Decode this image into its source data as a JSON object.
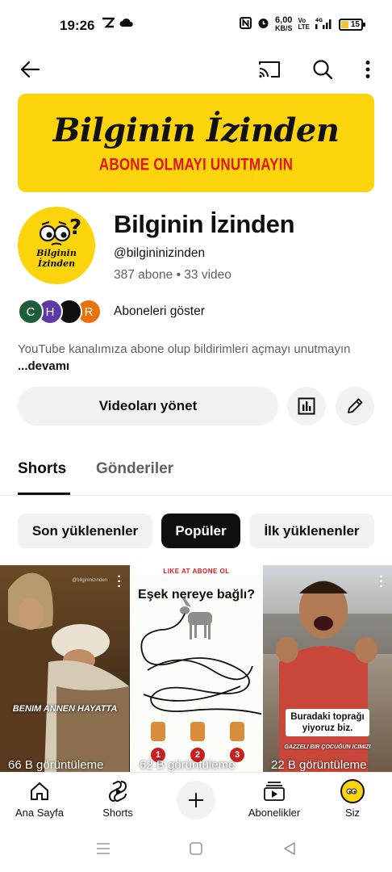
{
  "status_bar": {
    "time": "19:26",
    "speed_top": "6,00",
    "speed_bottom": "KB/S",
    "battery": "15",
    "network": "Vo LTE 4G"
  },
  "banner": {
    "title": "Bilginin İzinden",
    "subtitle": "ABONE OLMAYI UNUTMAYIN"
  },
  "channel": {
    "avatar_text": "Bilginin İzinden",
    "name": "Bilginin İzinden",
    "handle": "@bilgininizinden",
    "stats": "387 abone • 33 video",
    "subscriber_avatars": [
      {
        "letter": "C",
        "color": "#1e5e3a"
      },
      {
        "letter": "H",
        "color": "#5b3aa6"
      },
      {
        "letter": "",
        "color": "#0f0f0f"
      },
      {
        "letter": "R",
        "color": "#e8710a"
      }
    ],
    "show_subscribers": "Aboneleri göster",
    "description": "YouTube kanalımıza abone olup bildirimleri açmayı unutmayın",
    "more": "...devamı"
  },
  "actions": {
    "manage_videos": "Videoları yönet"
  },
  "tabs": [
    {
      "label": "Shorts",
      "active": true
    },
    {
      "label": "Gönderiler",
      "active": false
    }
  ],
  "chips": [
    {
      "label": "Son yüklenenler",
      "selected": false
    },
    {
      "label": "Popüler",
      "selected": true
    },
    {
      "label": "İlk yüklenenler",
      "selected": false
    }
  ],
  "shorts": [
    {
      "views": "66 B görüntüleme",
      "overlay_text": "BENIM ANNEN HAYATTA",
      "watermark": "@bilgininizinden"
    },
    {
      "views": "62 B görüntüleme",
      "top_text": "LIKE AT ABONE OL",
      "heading": "Eşek nereye bağlı?",
      "options": [
        "1",
        "2",
        "3"
      ]
    },
    {
      "views": "22 B görüntüleme",
      "caption": "Buradaki toprağı yiyoruz biz.",
      "bottom_text": "GAZZELI BIR ÇOCUĞUN ICIMIZI"
    }
  ],
  "bottom_nav": [
    {
      "label": "Ana Sayfa",
      "icon": "home-icon"
    },
    {
      "label": "Shorts",
      "icon": "shorts-icon"
    },
    {
      "label": "",
      "icon": "create-icon"
    },
    {
      "label": "Abonelikler",
      "icon": "subscriptions-icon"
    },
    {
      "label": "Siz",
      "icon": "profile-avatar"
    }
  ],
  "colors": {
    "brand_yellow": "#fbd40c",
    "banner_red": "#e0161b",
    "chip_bg": "#f2f2f2",
    "text_secondary": "#606060"
  }
}
